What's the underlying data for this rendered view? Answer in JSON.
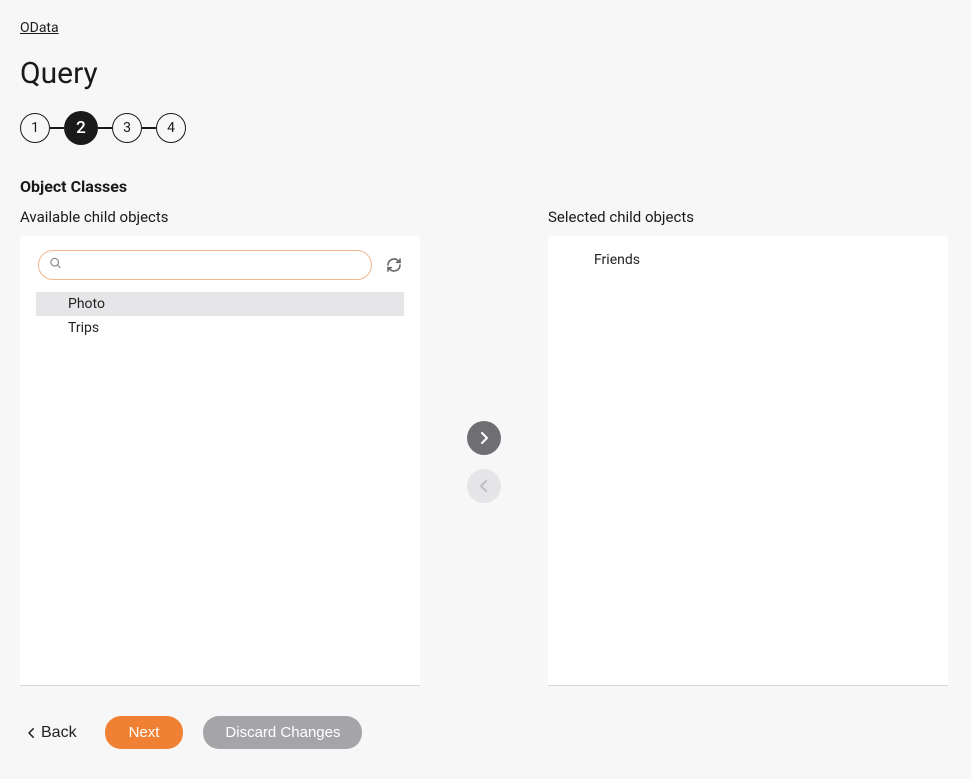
{
  "breadcrumb": "OData",
  "page_title": "Query",
  "stepper": {
    "steps": [
      "1",
      "2",
      "3",
      "4"
    ],
    "active_index": 1
  },
  "section_title": "Object Classes",
  "available": {
    "label": "Available child objects",
    "search_placeholder": "",
    "items": [
      {
        "label": "Photo",
        "highlighted": true
      },
      {
        "label": "Trips",
        "highlighted": false
      }
    ]
  },
  "selected": {
    "label": "Selected child objects",
    "items": [
      {
        "label": "Friends"
      }
    ]
  },
  "transfer": {
    "move_right_enabled": true,
    "move_left_enabled": false
  },
  "footer": {
    "back": "Back",
    "next": "Next",
    "discard": "Discard Changes"
  }
}
